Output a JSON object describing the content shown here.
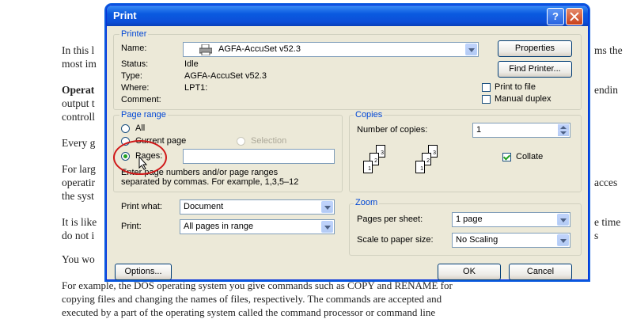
{
  "document": {
    "lines": [
      "In this l",
      "most im",
      "Operat",
      "output t",
      "controll",
      "Every g",
      "For larg",
      "operatir",
      "the syst",
      "It is like",
      "do not i",
      "You wo",
      "For example, the DOS operating system you give commands such as COPY and RENAME for",
      "copying files and changing the names of files, respectively. The commands are accepted and",
      "executed by a part of the operating system called the command processor or command line"
    ],
    "right_fragments": [
      "ms the",
      "endin",
      "acces",
      "e time",
      "s"
    ]
  },
  "dialog": {
    "title": "Print",
    "help_label": "?",
    "printer": {
      "group_label": "Printer",
      "name_label": "Name:",
      "name_value": "AGFA-AccuSet v52.3",
      "status_label": "Status:",
      "status_value": "Idle",
      "type_label": "Type:",
      "type_value": "AGFA-AccuSet v52.3",
      "where_label": "Where:",
      "where_value": "LPT1:",
      "comment_label": "Comment:",
      "properties_button": "Properties",
      "find_printer_button": "Find Printer...",
      "print_to_file_label": "Print to file",
      "manual_duplex_label": "Manual duplex"
    },
    "page_range": {
      "group_label": "Page range",
      "all_label": "All",
      "current_page_label": "Current page",
      "selection_label": "Selection",
      "pages_label": "Pages:",
      "pages_value": "",
      "help_text_1": "Enter page numbers and/or page ranges",
      "help_text_2": "separated by commas.  For example, 1,3,5–12"
    },
    "copies": {
      "group_label": "Copies",
      "number_label": "Number of copies:",
      "number_value": "1",
      "collate_label": "Collate"
    },
    "print_what": {
      "label": "Print what:",
      "value": "Document"
    },
    "print_which": {
      "label": "Print:",
      "value": "All pages in range"
    },
    "zoom": {
      "group_label": "Zoom",
      "pages_per_sheet_label": "Pages per sheet:",
      "pages_per_sheet_value": "1 page",
      "scale_label": "Scale to paper size:",
      "scale_value": "No Scaling"
    },
    "options_button": "Options...",
    "ok_button": "OK",
    "cancel_button": "Cancel"
  },
  "colors": {
    "title_blue": "#0a5ae0",
    "group_title": "#0046d5",
    "dialog_bg": "#ece9d8",
    "annotation_red": "#d01919"
  }
}
